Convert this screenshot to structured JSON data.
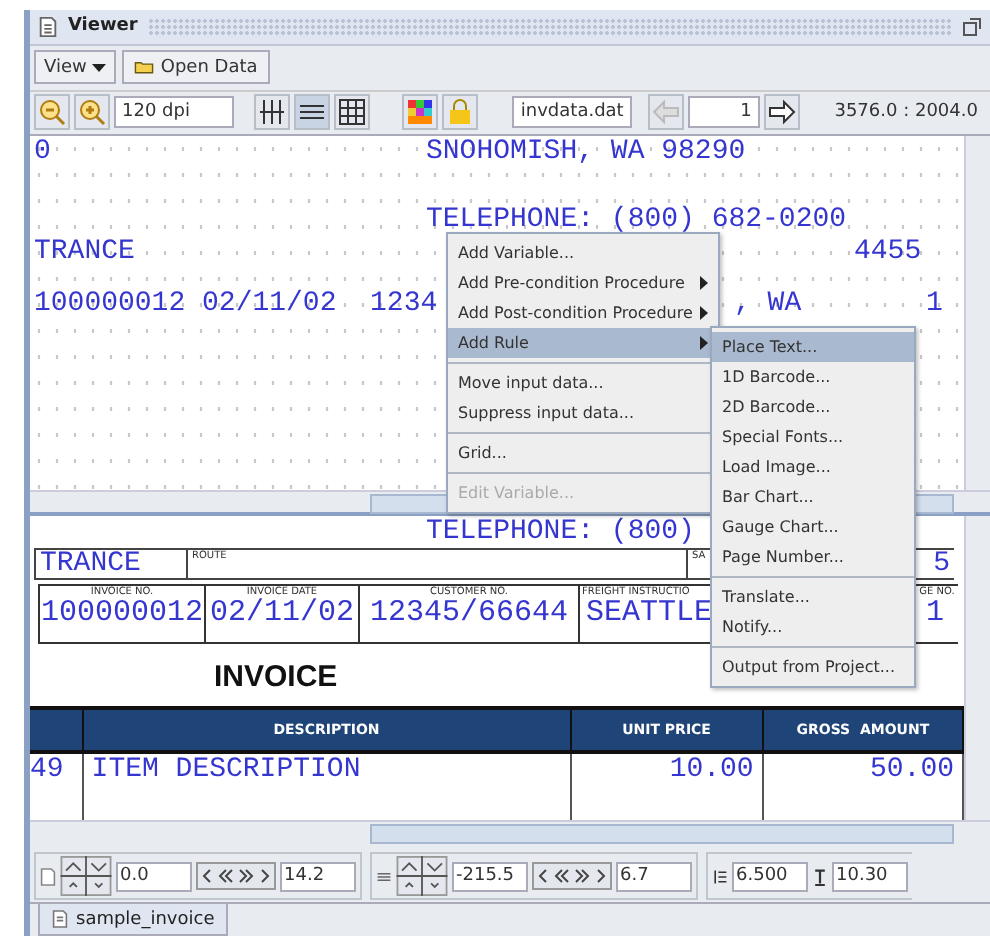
{
  "window": {
    "title": "Viewer"
  },
  "toolbar": {
    "view_menu": "View",
    "open_data": "Open Data",
    "dpi": "120 dpi",
    "data_file": "invdata.dat",
    "page": "1",
    "coordinates": "3576.0 : 2004.0"
  },
  "top_pane": {
    "texts": [
      "0",
      "SNOHOMISH, WA 98290",
      "TELEPHONE: (800) 682-0200",
      "TRANCE",
      "4455",
      "100000012 02/11/02  1234",
      ", WA",
      "1"
    ]
  },
  "context_menu": {
    "items": [
      {
        "kind": "item",
        "label": "Add Variable...",
        "disabled": false,
        "selected": false
      },
      {
        "kind": "submenu",
        "label": "Add Pre-condition Procedure",
        "disabled": false,
        "selected": false
      },
      {
        "kind": "submenu",
        "label": "Add Post-condition Procedure",
        "disabled": false,
        "selected": false
      },
      {
        "kind": "submenu",
        "label": "Add Rule",
        "disabled": false,
        "selected": true
      },
      {
        "kind": "separator"
      },
      {
        "kind": "item",
        "label": "Move input data...",
        "disabled": false,
        "selected": false
      },
      {
        "kind": "item",
        "label": "Suppress input data...",
        "disabled": false,
        "selected": false
      },
      {
        "kind": "separator"
      },
      {
        "kind": "item",
        "label": "Grid...",
        "disabled": false,
        "selected": false
      },
      {
        "kind": "separator"
      },
      {
        "kind": "item",
        "label": "Edit Variable...",
        "disabled": true,
        "selected": false
      }
    ]
  },
  "submenu": {
    "items": [
      {
        "kind": "item",
        "label": "Place Text...",
        "selected": true
      },
      {
        "kind": "item",
        "label": "1D Barcode...",
        "selected": false
      },
      {
        "kind": "item",
        "label": "2D Barcode...",
        "selected": false
      },
      {
        "kind": "item",
        "label": "Special Fonts...",
        "selected": false
      },
      {
        "kind": "item",
        "label": "Load Image...",
        "selected": false
      },
      {
        "kind": "item",
        "label": "Bar Chart...",
        "selected": false
      },
      {
        "kind": "item",
        "label": "Gauge Chart...",
        "selected": false
      },
      {
        "kind": "item",
        "label": "Page Number...",
        "selected": false
      },
      {
        "kind": "separator"
      },
      {
        "kind": "item",
        "label": "Translate...",
        "selected": false
      },
      {
        "kind": "item",
        "label": "Notify...",
        "selected": false
      },
      {
        "kind": "separator"
      },
      {
        "kind": "item",
        "label": "Output from Project...",
        "selected": false
      }
    ]
  },
  "bottom_pane": {
    "telephone": "TELEPHONE: (800)",
    "address_row": [
      {
        "value": "TRANCE"
      },
      {
        "label": "ROUTE"
      },
      {
        "label": "SA",
        "value": "5"
      }
    ],
    "info_row": [
      {
        "label": "INVOICE NO.",
        "value": "100000012"
      },
      {
        "label": "INVOICE DATE",
        "value": "02/11/02"
      },
      {
        "label": "CUSTOMER NO.",
        "value": "12345/66644"
      },
      {
        "label": "FREIGHT INSTRUCTIO",
        "value": "SEATTLE"
      },
      {
        "label": "GE NO.",
        "value": "1"
      }
    ],
    "heading": "INVOICE",
    "columns": [
      "",
      "DESCRIPTION",
      "UNIT PRICE",
      "GROSS  AMOUNT"
    ],
    "row": [
      "49",
      "ITEM DESCRIPTION",
      "10.00",
      "50.00"
    ]
  },
  "position_bar": {
    "fields": [
      "0.0",
      "14.2",
      "-215.5",
      "6.7",
      "6.500",
      "10.30"
    ]
  },
  "document_tab": {
    "label": "sample_invoice"
  }
}
